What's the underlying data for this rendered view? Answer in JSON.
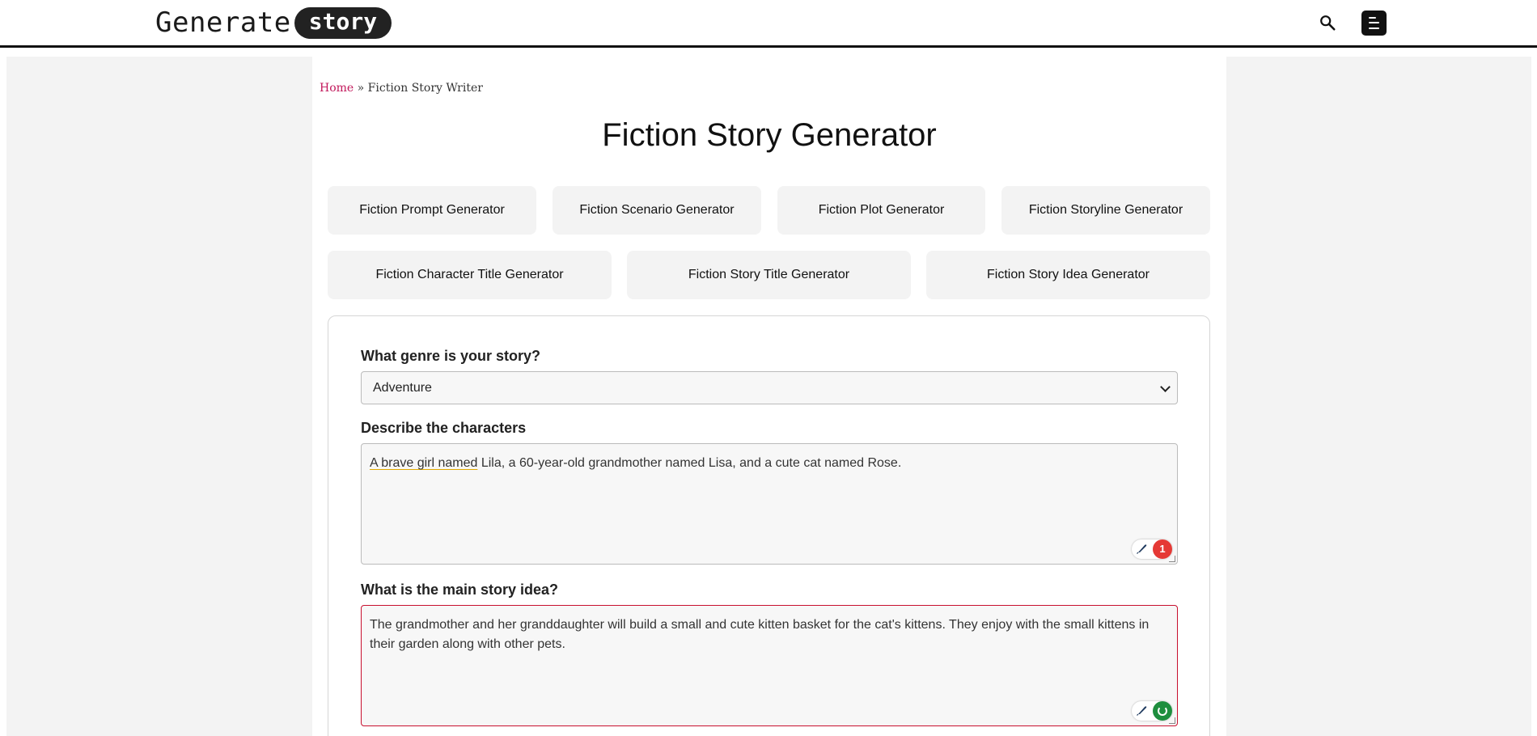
{
  "header": {
    "logo_word": "Generate",
    "logo_pill": "story",
    "search_icon": "search-icon",
    "menu_icon": "menu-icon"
  },
  "breadcrumb": {
    "home": "Home",
    "separator": " » ",
    "current": "Fiction Story Writer"
  },
  "page_title": "Fiction Story Generator",
  "tools_row1": [
    "Fiction Prompt Generator",
    "Fiction Scenario Generator",
    "Fiction Plot Generator",
    "Fiction Storyline Generator"
  ],
  "tools_row2": [
    "Fiction Character Title Generator",
    "Fiction Story Title Generator",
    "Fiction Story Idea Generator"
  ],
  "form": {
    "genre_label": "What genre is your story?",
    "genre_value": "Adventure",
    "characters_label": "Describe the characters",
    "characters_value_underlined": "A brave girl named",
    "characters_value_rest": " Lila, a 60-year-old grandmother named Lisa, and a cute cat named Rose.",
    "characters_badge": "1",
    "idea_label": "What is the main story idea?",
    "idea_value": "The grandmother and her granddaughter will build a small and cute kitten basket for the cat's kittens. They enjoy with the small kittens in their garden along with other pets."
  },
  "colors": {
    "accent_link": "#c2185b",
    "active_border": "#c8102e",
    "badge_error": "#e53935",
    "badge_ok": "#1e8e3e"
  }
}
